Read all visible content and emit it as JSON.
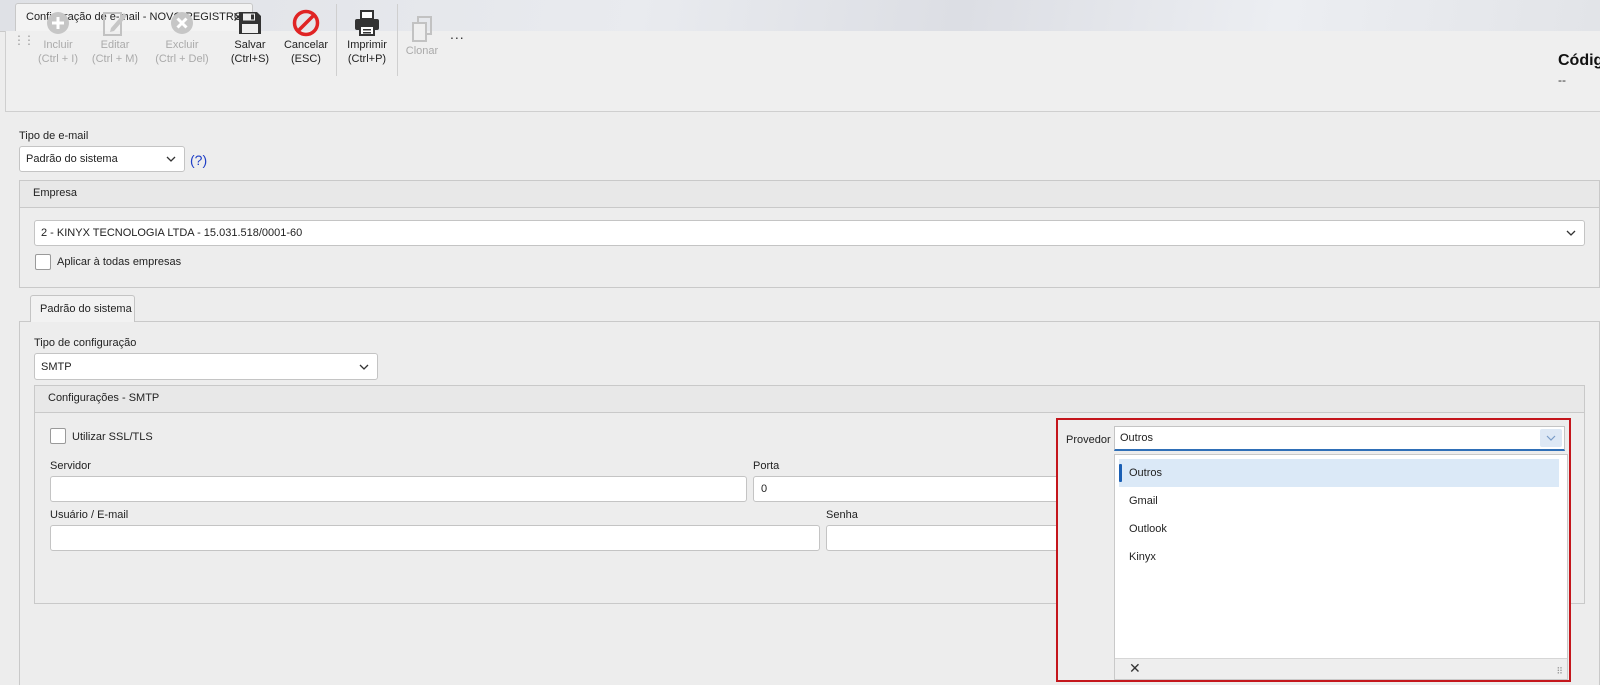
{
  "window": {
    "tab_title": "Configuração de e-mail - NOVO REGISTRO",
    "close_glyph": "✕"
  },
  "toolbar": {
    "buttons": [
      {
        "line1": "Incluir",
        "line2": "(Ctrl + I)",
        "icon": "plus-circle-icon",
        "enabled": false
      },
      {
        "line1": "Editar",
        "line2": "(Ctrl + M)",
        "icon": "edit-icon",
        "enabled": false
      },
      {
        "line1": "Excluir",
        "line2": "(Ctrl + Del)",
        "icon": "delete-circle-icon",
        "enabled": false
      },
      {
        "line1": "Salvar",
        "line2": "(Ctrl+S)",
        "icon": "save-icon",
        "enabled": true
      },
      {
        "line1": "Cancelar",
        "line2": "(ESC)",
        "icon": "cancel-icon",
        "enabled": true
      },
      {
        "line1": "Imprimir",
        "line2": "(Ctrl+P)",
        "icon": "printer-icon",
        "enabled": true
      },
      {
        "line1": "Clonar",
        "line2": "",
        "icon": "clone-icon",
        "enabled": false
      }
    ],
    "more": "...",
    "code_title": "Códig",
    "code_value": "--"
  },
  "email_type": {
    "label": "Tipo de e-mail",
    "value": "Padrão do sistema",
    "help": "(?)"
  },
  "empresa": {
    "title": "Empresa",
    "value": "2 - KINYX TECNOLOGIA LTDA - 15.031.518/0001-60",
    "apply_all_label": "Aplicar à todas empresas"
  },
  "tab": {
    "label": "Padrão do sistema"
  },
  "config_type": {
    "label": "Tipo de configuração",
    "value": "SMTP"
  },
  "smtp": {
    "title": "Configurações - SMTP",
    "ssl_label": "Utilizar SSL/TLS",
    "server_label": "Servidor",
    "server_value": "",
    "port_label": "Porta",
    "port_value": "0",
    "user_label": "Usuário / E-mail",
    "user_value": "",
    "password_label": "Senha",
    "password_value": ""
  },
  "provider": {
    "label": "Provedor",
    "value": "Outros",
    "options": [
      "Outros",
      "Gmail",
      "Outlook",
      "Kinyx"
    ],
    "selected_index": 0,
    "clear_glyph": "✕",
    "highlight_color": "#c4161c"
  }
}
